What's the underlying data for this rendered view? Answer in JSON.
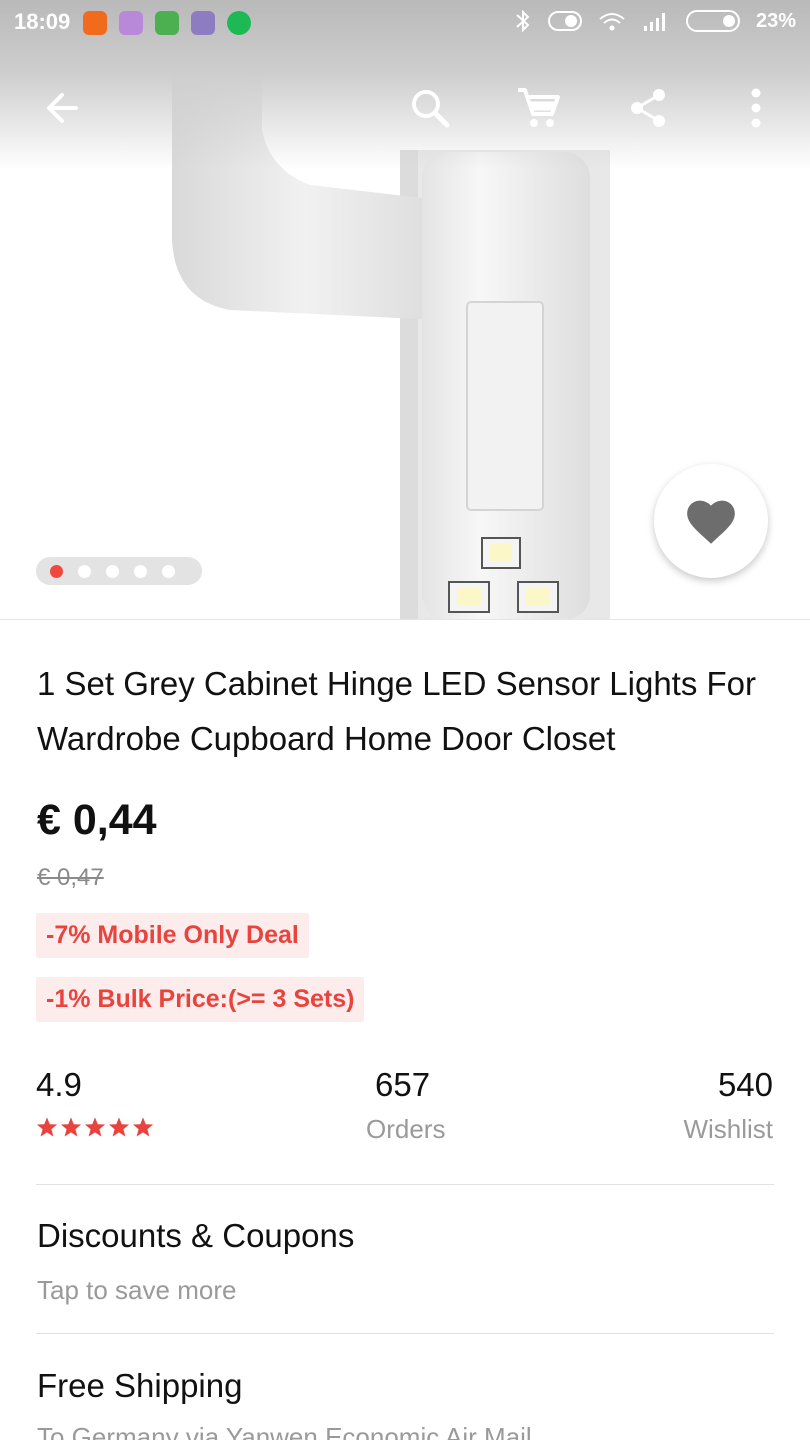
{
  "status_bar": {
    "time": "18:09",
    "battery": "23%",
    "app_icons": [
      {
        "name": "mi-app-icon",
        "color": "#f26b1d"
      },
      {
        "name": "gmail-icon",
        "color": "#b889d8"
      },
      {
        "name": "cat-app-icon",
        "color": "#4caf50"
      },
      {
        "name": "play-store-icon",
        "color": "#8e7cc3"
      },
      {
        "name": "spotify-icon",
        "color": "#1db954"
      }
    ]
  },
  "toolbar": {
    "back_icon": "arrow-left",
    "search_icon": "magnifier",
    "cart_icon": "shopping-cart",
    "share_icon": "share",
    "more_icon": "vertical-dots"
  },
  "gallery": {
    "dot_count": 5,
    "active_index": 0,
    "wishlist_icon": "heart"
  },
  "product": {
    "title": "1 Set Grey Cabinet Hinge LED Sensor Lights For Wardrobe Cupboard Home Door Closet",
    "price": "€ 0,44",
    "old_price": "€ 0,47",
    "badges": [
      "-7% Mobile Only Deal",
      "-1% Bulk Price:(>= 3 Sets)"
    ]
  },
  "stats": {
    "rating": "4.9",
    "stars": 5,
    "orders_count": "657",
    "orders_label": "Orders",
    "wishlist_count": "540",
    "wishlist_label": "Wishlist"
  },
  "sections": {
    "discounts_title": "Discounts & Coupons",
    "discounts_sub": "Tap to save more",
    "shipping_title": "Free Shipping",
    "shipping_sub": "To Germany via Yanwen Economic Air Mail"
  },
  "colors": {
    "accent_red": "#e8433c",
    "badge_bg": "#fdecec",
    "muted_text": "#9a9a9a"
  }
}
